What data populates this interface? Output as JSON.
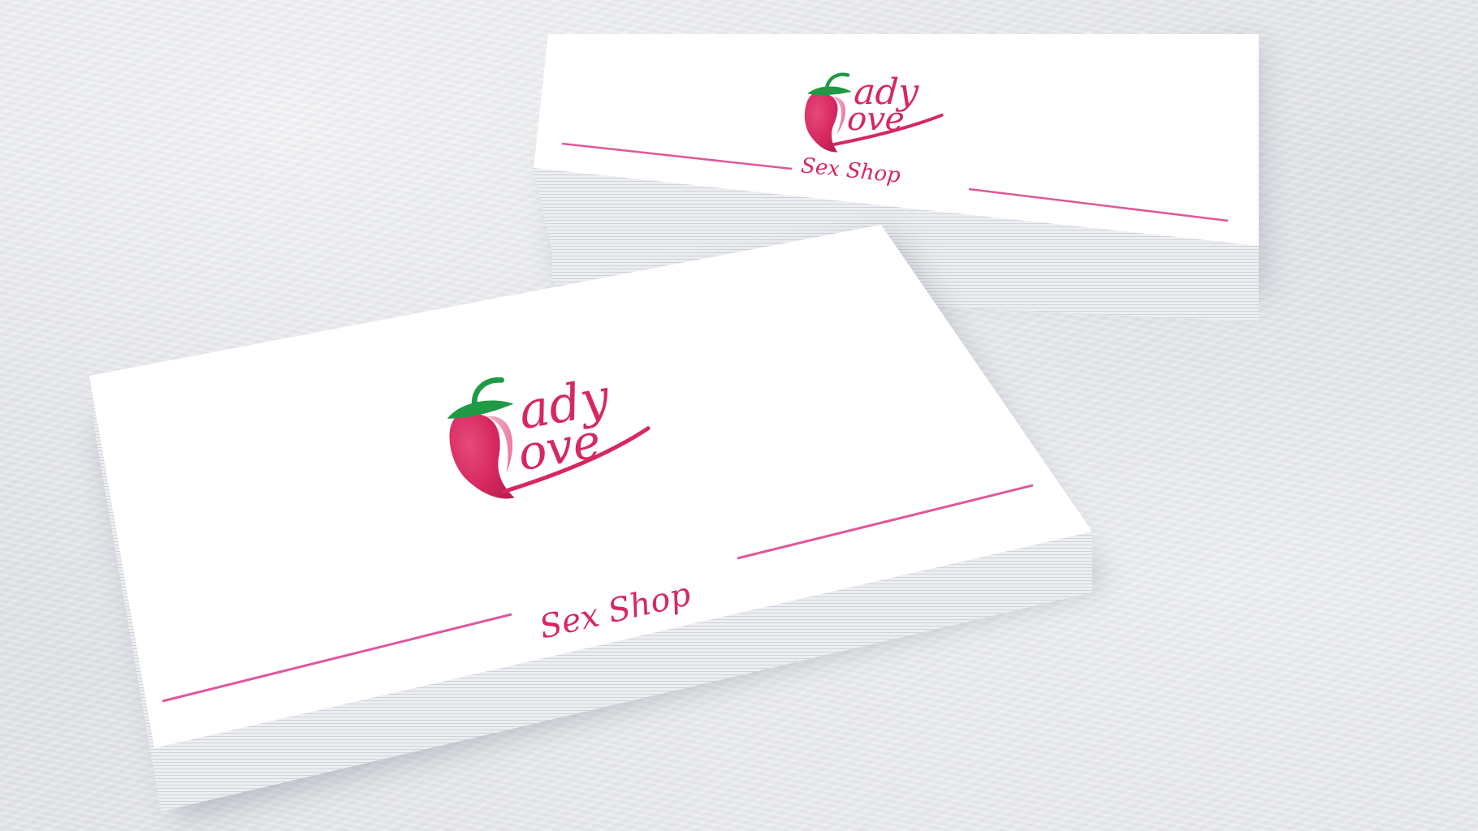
{
  "scene": {
    "description_colors": {
      "brand_pink": "#d6285f",
      "line_pink": "#e0579a",
      "leaf_green": "#1f9a45",
      "card_white": "#ffffff"
    }
  },
  "back_card": {
    "logo": {
      "line1": "ady",
      "line2": "ove",
      "icon": "strawberry-icon"
    },
    "tagline": "Sex Shop"
  },
  "front_card": {
    "logo": {
      "line1": "ady",
      "line2": "ove",
      "icon": "strawberry-icon"
    },
    "tagline": "Sex Shop"
  }
}
